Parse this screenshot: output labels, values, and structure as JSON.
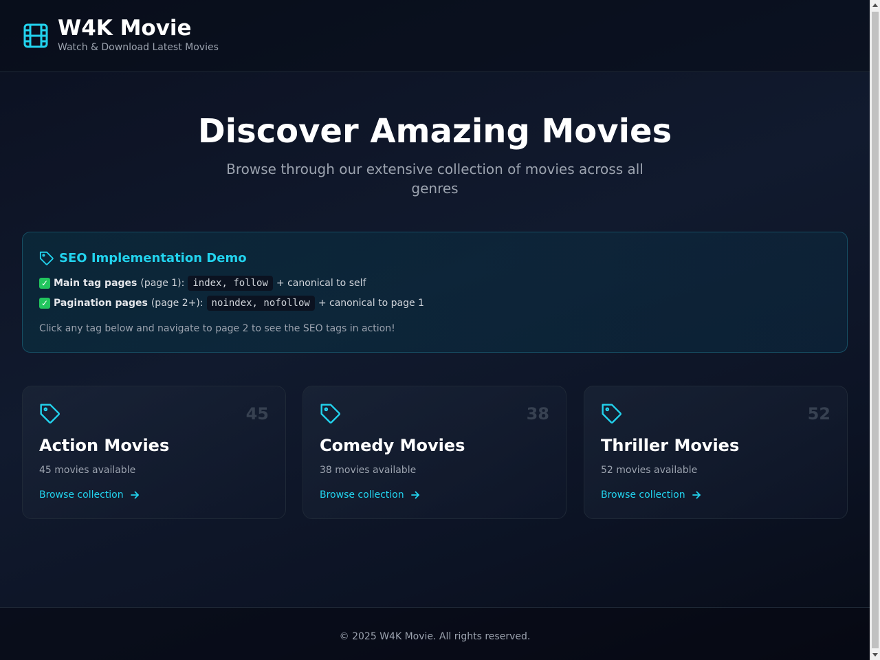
{
  "header": {
    "title": "W4K Movie",
    "subtitle": "Watch & Download Latest Movies",
    "logo_icon": "film-icon"
  },
  "hero": {
    "title": "Discover Amazing Movies",
    "subtitle": "Browse through our extensive collection of movies across all genres"
  },
  "seo_demo": {
    "title": "SEO Implementation Demo",
    "icon": "tag-icon",
    "lines": [
      {
        "check": "✓",
        "label": "Main tag pages",
        "scope": "(page 1):",
        "code": "index, follow",
        "after": "+ canonical to self"
      },
      {
        "check": "✓",
        "label": "Pagination pages",
        "scope": "(page 2+):",
        "code": "noindex, nofollow",
        "after": "+ canonical to page 1"
      }
    ],
    "note": "Click any tag below and navigate to page 2 to see the SEO tags in action!"
  },
  "cards": [
    {
      "count": "45",
      "title": "Action Movies",
      "subtitle": "45 movies available",
      "link": "Browse collection"
    },
    {
      "count": "38",
      "title": "Comedy Movies",
      "subtitle": "38 movies available",
      "link": "Browse collection"
    },
    {
      "count": "52",
      "title": "Thriller Movies",
      "subtitle": "52 movies available",
      "link": "Browse collection"
    }
  ],
  "footer": {
    "text": "© 2025 W4K Movie. All rights reserved."
  },
  "colors": {
    "accent": "#22d3ee",
    "background": "#0b1020",
    "check": "#22c55e"
  }
}
